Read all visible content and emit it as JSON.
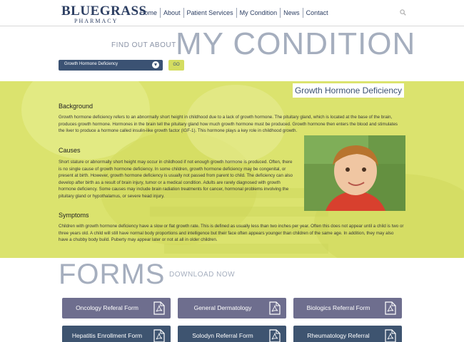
{
  "header": {
    "logo_main": "BLUEGRASS",
    "logo_sub": "PHARMACY",
    "nav": [
      "Home",
      "About",
      "Patient Services",
      "My Condition",
      "News",
      "Contact"
    ]
  },
  "hero": {
    "find_label": "FIND OUT ABOUT",
    "title": "MY CONDITION",
    "select_value": "Growth Hormone Deficiency",
    "go_label": "GO"
  },
  "condition": {
    "title": "Growth Hormone Deficiency",
    "sections": {
      "background_heading": "Background",
      "background_text": "Growth hormone deficiency refers to an abnormally short height in childhood due to a lack of growth hormone. The pituitary gland, which is located at the base of the brain, produces growth hormone. Hormones in the brain tell the pituitary gland how much growth hormone must be produced. Growth hormone then enters the blood and stimulates the liver to produce a hormone called insulin-like growth factor (IGF-1). This hormone plays a key role in childhood growth.",
      "causes_heading": "Causes",
      "causes_text": "Short stature or abnormally short height may occur in childhood if not enough growth hormone is produced. Often, there is no single cause of growth hormone deficiency. In some children, growth hormone deficiency may be congenital, or present at birth. However, growth hormone deficiency is usually not passed from parent to child. The deficiency can also develop after birth as a result of brain injury, tumor or a medical condition. Adults are rarely diagnosed with growth hormone deficiency. Some causes may include brain radiation treatments for cancer, hormonal problems involving the pituitary gland or hypothalamus, or severe head injury.",
      "symptoms_heading": "Symptoms",
      "symptoms_text": "Children with growth hormone deficiency have a slow or flat growth rate. This is defined as usually less than two inches per year. Often this does not appear until a child is two or three years old. A child will still have normal body proportions and intelligence but their face often appears younger than children of the same age. In addition, they may also have a chubby body build. Puberty may appear later or not at all in older children."
    }
  },
  "forms": {
    "title": "FORMS",
    "download_label": "DOWNLOAD NOW",
    "buttons": [
      {
        "label": "Oncology Referal Form"
      },
      {
        "label": "General Dermatology"
      },
      {
        "label": "Biologics Referral Form"
      },
      {
        "label": "Hepatitis Enrollment Form"
      },
      {
        "label": "Solodyn Referral Form"
      },
      {
        "label": "Rheumatology Referral"
      }
    ]
  },
  "colors": {
    "navy": "#2d3f63",
    "band_yellow": "#dbe36e",
    "title_gray": "#a5aebe",
    "form_row1": "#6e6e8e",
    "form_row2": "#3e5470"
  },
  "icons": [
    "search-icon",
    "chevron-down-icon",
    "pdf-icon"
  ]
}
